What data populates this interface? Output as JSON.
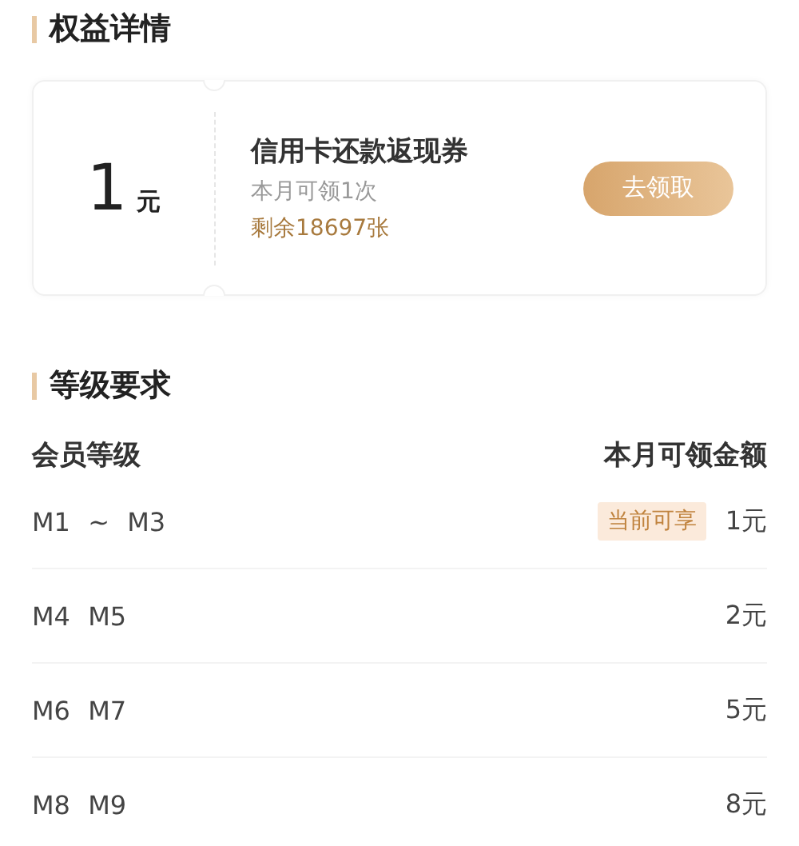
{
  "benefit_section": {
    "title": "权益详情"
  },
  "coupon": {
    "amount": "1",
    "unit": "元",
    "title": "信用卡还款返现券",
    "limit": "本月可领1次",
    "remaining": "剩余18697张",
    "button": "去领取"
  },
  "level_section": {
    "title": "等级要求"
  },
  "table": {
    "columns": [
      "会员等级",
      "本月可领金额"
    ],
    "rows": [
      {
        "tier": "M1 ~ M3",
        "amount": "1元",
        "badge": "当前可享"
      },
      {
        "tier": "M4 M5",
        "amount": "2元"
      },
      {
        "tier": "M6 M7",
        "amount": "5元"
      },
      {
        "tier": "M8 M9",
        "amount": "8元"
      }
    ]
  }
}
